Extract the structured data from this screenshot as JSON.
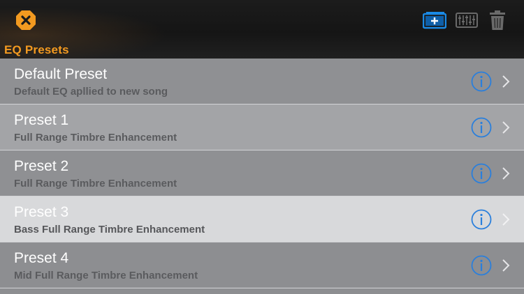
{
  "header": {
    "title": "EQ Presets",
    "close_icon": "close-x-icon",
    "toolbar_icons": [
      "add-preset-icon",
      "equalizer-icon",
      "trash-icon"
    ]
  },
  "colors": {
    "accent_orange": "#f39a20",
    "toolbar_blue": "#1a8ae6",
    "toolbar_disabled": "#6a6a6a",
    "info_blue": "#2a7fdc"
  },
  "presets": [
    {
      "title": "Default Preset",
      "subtitle": "Default EQ apllied to new song"
    },
    {
      "title": "Preset 1",
      "subtitle": "Full Range Timbre Enhancement"
    },
    {
      "title": "Preset 2",
      "subtitle": "Full Range Timbre Enhancement"
    },
    {
      "title": "Preset 3",
      "subtitle": "Bass Full Range Timbre Enhancement"
    },
    {
      "title": "Preset 4",
      "subtitle": "Mid Full Range Timbre Enhancement"
    }
  ]
}
